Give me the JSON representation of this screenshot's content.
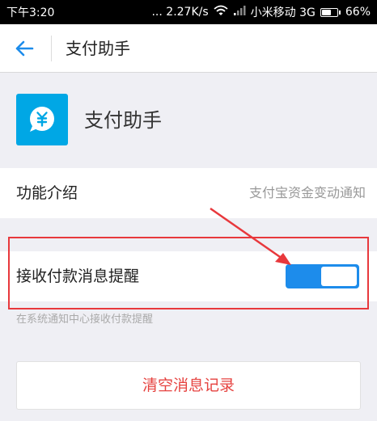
{
  "status_bar": {
    "time": "下午3:20",
    "network_speed": "... 2.27K/s",
    "carrier": "小米移动 3G",
    "battery_percent": "66%",
    "battery_level": 0.66,
    "icons": [
      "wifi-icon",
      "signal-icon",
      "battery-icon"
    ]
  },
  "nav": {
    "title": "支付助手",
    "back_icon": "arrow-left-icon"
  },
  "app": {
    "name": "支付助手",
    "icon": "yuan-chat-bubble-icon",
    "icon_color": "#00a7e5"
  },
  "intro": {
    "label": "功能介绍",
    "value": "支付宝资金变动通知"
  },
  "payment_notification": {
    "label": "接收付款消息提醒",
    "enabled": true,
    "hint": "在系统通知中心接收付款提醒",
    "accent_color": "#1d8ceb"
  },
  "clear_button": {
    "label": "清空消息记录",
    "color": "#e64340"
  },
  "annotation": {
    "color": "#e8383c"
  }
}
